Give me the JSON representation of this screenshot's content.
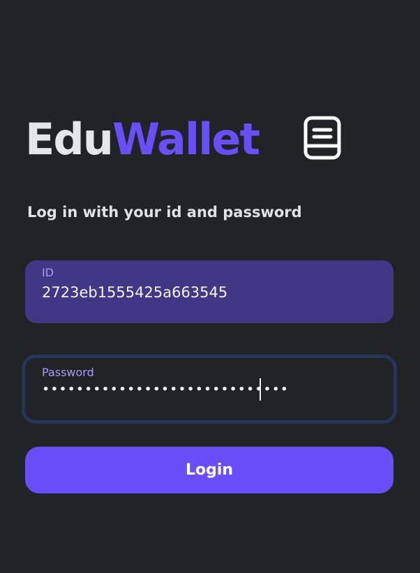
{
  "brand": {
    "name_part1": "Edu",
    "name_part2": "Wallet",
    "icon": "book-icon",
    "colors": {
      "primary_text": "#e4e6ea",
      "accent": "#6a4ff8"
    }
  },
  "login": {
    "subtitle": "Log in with your id and password",
    "id_field": {
      "label": "ID",
      "value": "2723eb1555425a663545"
    },
    "password_field": {
      "label": "Password",
      "masked_value": "•••••••••••••••••••••••••••••"
    },
    "button_label": "Login"
  },
  "colors": {
    "background": "#212327",
    "id_field_bg": "#413784",
    "password_focus_border": "#25365a",
    "button_bg": "#6a4ff8"
  }
}
